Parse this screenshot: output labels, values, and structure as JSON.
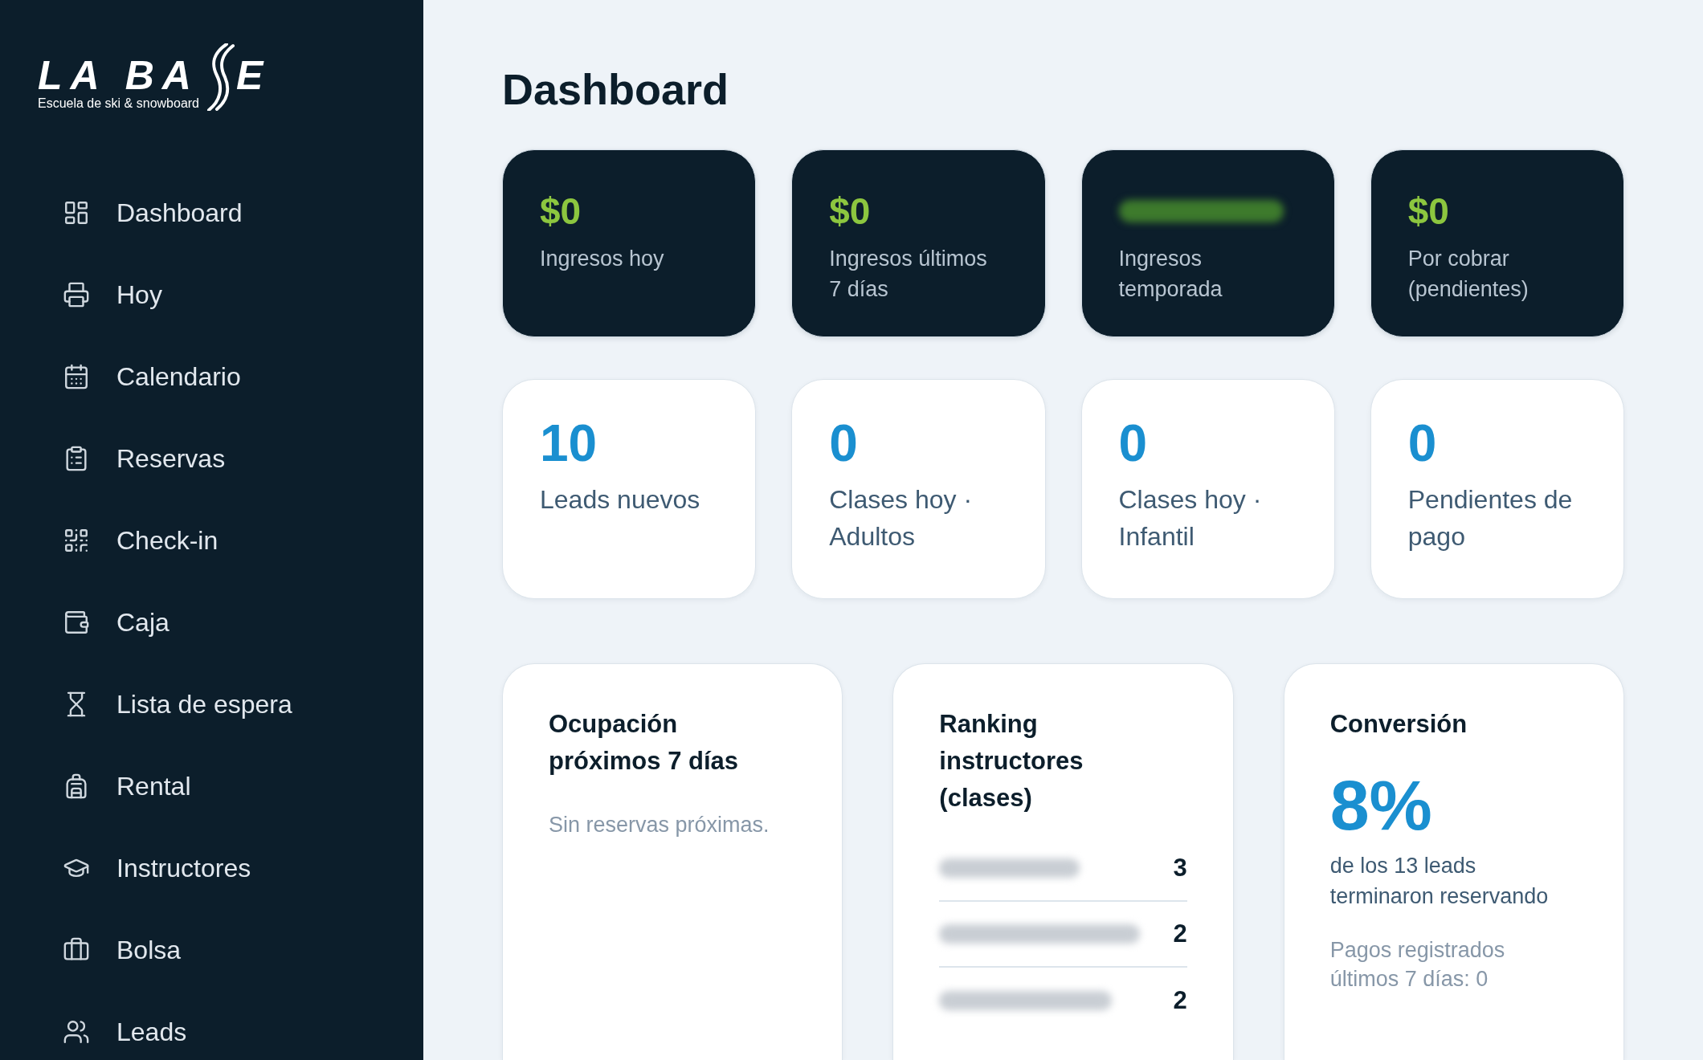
{
  "logo": {
    "letters_left": "LA BA",
    "letters_right": "E",
    "tagline": "Escuela de ski & snowboard"
  },
  "sidebar": {
    "items": [
      {
        "label": "Dashboard"
      },
      {
        "label": "Hoy"
      },
      {
        "label": "Calendario"
      },
      {
        "label": "Reservas"
      },
      {
        "label": "Check-in"
      },
      {
        "label": "Caja"
      },
      {
        "label": "Lista de espera"
      },
      {
        "label": "Rental"
      },
      {
        "label": "Instructores"
      },
      {
        "label": "Bolsa"
      },
      {
        "label": "Leads"
      }
    ]
  },
  "page": {
    "title": "Dashboard"
  },
  "revenue_cards": [
    {
      "value": "$0",
      "label": "Ingresos hoy",
      "redacted": false
    },
    {
      "value": "$0",
      "label": "Ingresos últimos 7 días",
      "redacted": false
    },
    {
      "label": "Ingresos temporada",
      "redacted": true
    },
    {
      "value": "$0",
      "label": "Por cobrar (pendientes)",
      "redacted": false
    }
  ],
  "stat_cards": [
    {
      "value": "10",
      "label": "Leads nuevos"
    },
    {
      "value": "0",
      "label": "Clases hoy · Adultos"
    },
    {
      "value": "0",
      "label": "Clases hoy · Infantil"
    },
    {
      "value": "0",
      "label": "Pendientes de pago"
    }
  ],
  "occupancy": {
    "title": "Ocupación próximos 7 días",
    "empty_message": "Sin reservas próximas."
  },
  "ranking": {
    "title": "Ranking instructores (clases)",
    "rows": [
      {
        "count": "3"
      },
      {
        "count": "2"
      },
      {
        "count": "2"
      }
    ]
  },
  "conversion": {
    "title": "Conversión",
    "rate": "8%",
    "description": "de los 13 leads terminaron reservando",
    "payments_note": "Pagos registrados últimos 7 días: 0"
  }
}
